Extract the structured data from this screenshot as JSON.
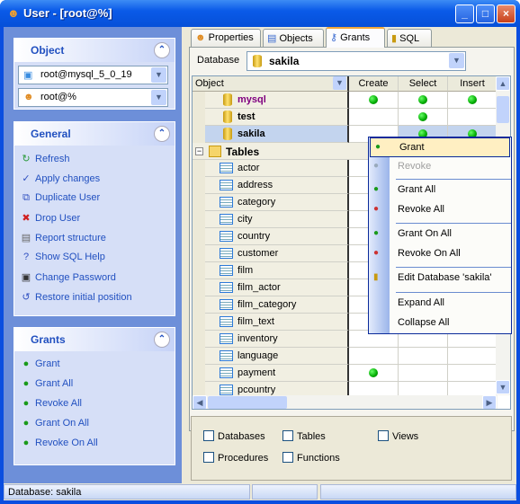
{
  "window": {
    "title": "User - [root@%]",
    "buttons": [
      "_",
      "□",
      "×"
    ]
  },
  "left": {
    "object": {
      "title": "Object",
      "server": "root@mysql_5_0_19",
      "user": "root@%"
    },
    "general": {
      "title": "General",
      "items": [
        "Refresh",
        "Apply changes",
        "Duplicate User",
        "Drop User",
        "Report structure",
        "Show SQL Help",
        "Change Password",
        "Restore initial position"
      ],
      "icons": [
        "refresh-icon",
        "apply-icon",
        "duplicate-user-icon",
        "drop-icon",
        "report-icon",
        "help-icon",
        "password-icon",
        "restore-icon"
      ]
    },
    "grants": {
      "title": "Grants",
      "items": [
        "Grant",
        "Grant All",
        "Revoke All",
        "Grant On All",
        "Revoke On All"
      ]
    }
  },
  "tabs": [
    {
      "label": "Properties"
    },
    {
      "label": "Objects"
    },
    {
      "label": "Grants",
      "active": true
    },
    {
      "label": "SQL"
    }
  ],
  "database": {
    "label": "Database",
    "value": "sakila"
  },
  "grid": {
    "columns": [
      "Object",
      "Create",
      "Select",
      "Insert"
    ],
    "databases": [
      {
        "name": "mysql",
        "create": true,
        "select": true,
        "insert": true,
        "color": "#800080"
      },
      {
        "name": "test",
        "create": false,
        "select": true,
        "insert": false
      },
      {
        "name": "sakila",
        "create": false,
        "select": true,
        "insert": true,
        "selected": true
      }
    ],
    "group": "Tables",
    "tables": [
      {
        "name": "actor"
      },
      {
        "name": "address"
      },
      {
        "name": "category"
      },
      {
        "name": "city"
      },
      {
        "name": "country"
      },
      {
        "name": "customer"
      },
      {
        "name": "film"
      },
      {
        "name": "film_actor"
      },
      {
        "name": "film_category"
      },
      {
        "name": "film_text"
      },
      {
        "name": "inventory"
      },
      {
        "name": "language"
      },
      {
        "name": "payment",
        "create": true
      },
      {
        "name": "pcountry"
      }
    ]
  },
  "context_menu": {
    "items": [
      {
        "label": "Grant",
        "highlighted": true
      },
      {
        "label": "Revoke",
        "disabled": true
      },
      {
        "label": "Grant All"
      },
      {
        "label": "Revoke All"
      },
      {
        "label": "Grant On All"
      },
      {
        "label": "Revoke On All"
      },
      {
        "label": "Edit Database 'sakila'"
      },
      {
        "label": "Expand All"
      },
      {
        "label": "Collapse All"
      }
    ]
  },
  "filters": {
    "databases": "Databases",
    "tables": "Tables",
    "views": "Views",
    "procedures": "Procedures",
    "functions": "Functions"
  },
  "status": {
    "text": "Database: sakila"
  }
}
